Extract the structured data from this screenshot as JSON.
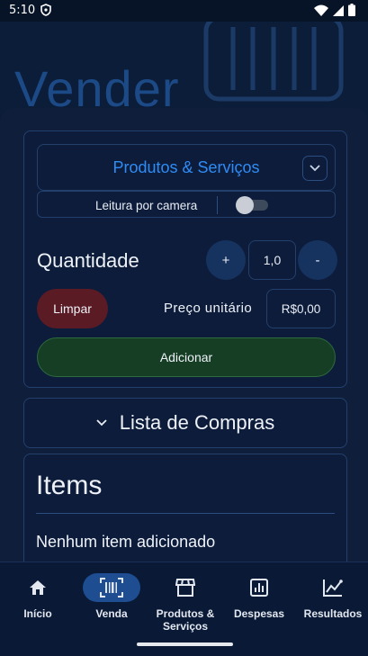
{
  "status": {
    "time": "5:10"
  },
  "header": {
    "title": "Vender"
  },
  "form": {
    "category": "Produtos & Serviços",
    "camera_label": "Leitura por camera",
    "quantity_label": "Quantidade",
    "plus": "+",
    "quantity_value": "1,0",
    "minus": "-",
    "clear_label": "Limpar",
    "unit_price_label": "Preço unitário",
    "unit_price_value": "R$0,00",
    "add_label": "Adicionar"
  },
  "shopping_list": {
    "title": "Lista de Compras"
  },
  "items": {
    "title": "Items",
    "empty": "Nenhum item adicionado"
  },
  "nav": {
    "items": [
      {
        "label": "Início",
        "icon": "home-icon"
      },
      {
        "label": "Venda",
        "icon": "barcode-scan-icon",
        "active": true
      },
      {
        "label": "Produtos & Serviços",
        "icon": "store-icon"
      },
      {
        "label": "Despesas",
        "icon": "chart-box-icon"
      },
      {
        "label": "Resultados",
        "icon": "trending-chart-icon"
      }
    ]
  },
  "colors": {
    "accent": "#2f8cf5",
    "danger": "#5a1b24",
    "success": "#163e25",
    "background": "#0b1a33"
  }
}
